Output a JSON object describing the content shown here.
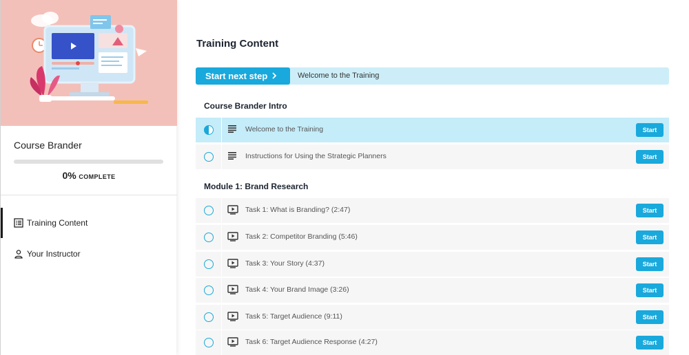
{
  "sidebar": {
    "course_title": "Course Brander",
    "progress_fraction": 0.0,
    "progress_percent": "0%",
    "progress_label": "COMPLETE",
    "nav": [
      {
        "label": "Training Content",
        "icon": "list-icon",
        "active": true
      },
      {
        "label": "Your Instructor",
        "icon": "person-icon",
        "active": false
      }
    ],
    "hero_illustration": "computer-monitor-illustration"
  },
  "main": {
    "title": "Training Content",
    "next_step": {
      "button_label": "Start next step",
      "current": "Welcome to the Training"
    },
    "sections": [
      {
        "title": "Course Brander Intro",
        "items": [
          {
            "title": "Welcome to the Training",
            "type": "text-icon",
            "status": "in-progress",
            "action": "Start"
          },
          {
            "title": "Instructions for Using the Strategic Planners",
            "type": "text-icon",
            "status": "not-started",
            "action": "Start"
          }
        ]
      },
      {
        "title": "Module 1: Brand Research",
        "items": [
          {
            "title": "Task 1: What is Branding? (2:47)",
            "type": "video-icon",
            "status": "not-started",
            "action": "Start"
          },
          {
            "title": "Task 2: Competitor Branding (5:46)",
            "type": "video-icon",
            "status": "not-started",
            "action": "Start"
          },
          {
            "title": "Task 3: Your Story (4:37)",
            "type": "video-icon",
            "status": "not-started",
            "action": "Start"
          },
          {
            "title": "Task 4: Your Brand Image (3:26)",
            "type": "video-icon",
            "status": "not-started",
            "action": "Start"
          },
          {
            "title": "Task 5: Target Audience (9:11)",
            "type": "video-icon",
            "status": "not-started",
            "action": "Start"
          },
          {
            "title": "Task 6: Target Audience Response (4:27)",
            "type": "video-icon",
            "status": "not-started",
            "action": "Start"
          }
        ]
      }
    ]
  },
  "colors": {
    "accent": "#19a9dc",
    "active_row": "#c4ecf9",
    "hero_bg": "#f3c0b9"
  }
}
